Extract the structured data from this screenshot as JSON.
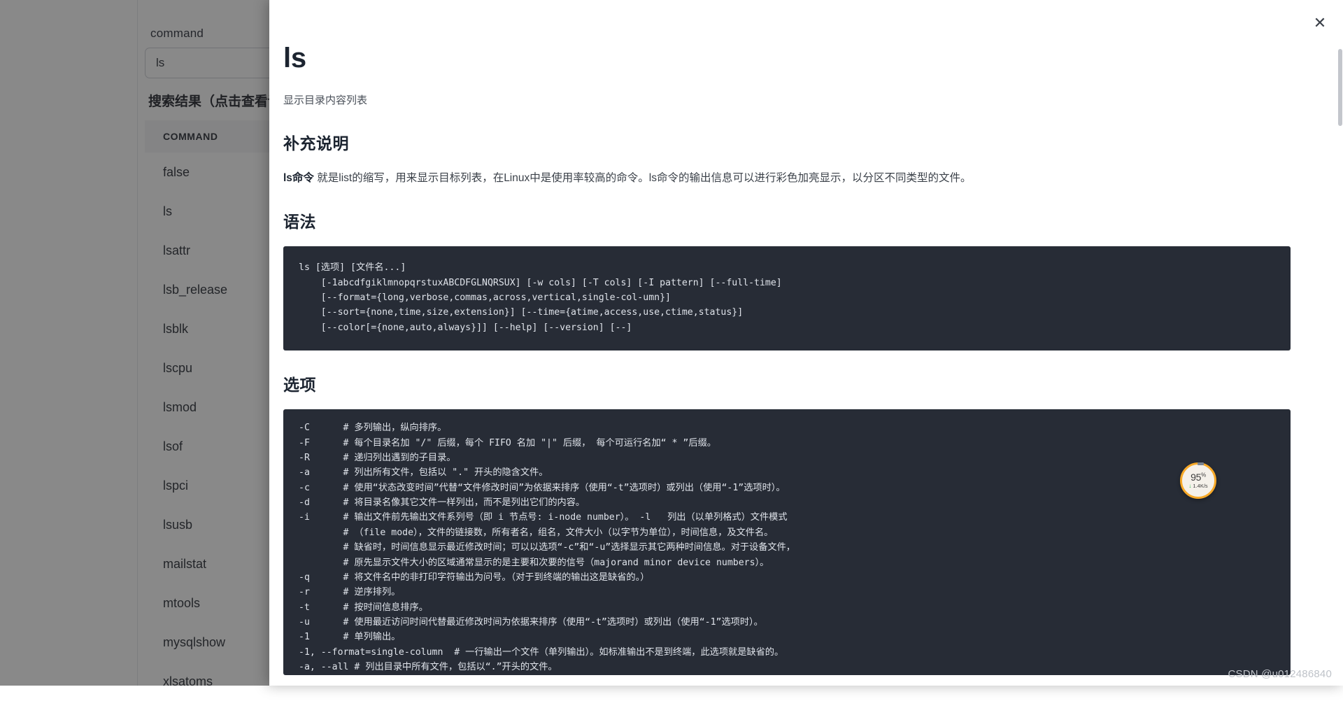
{
  "background": {
    "field_label": "command",
    "search_input_value": "ls",
    "search_input_placeholder": "command",
    "results_title": "搜索结果（点击查看详情）",
    "table": {
      "header": "COMMAND",
      "rows": [
        "false",
        "ls",
        "lsattr",
        "lsb_release",
        "lsblk",
        "lscpu",
        "lsmod",
        "lsof",
        "lspci",
        "lsusb",
        "mailstat",
        "mtools",
        "mysqlshow",
        "xlsatoms"
      ]
    }
  },
  "modal": {
    "close_icon_label": "✕",
    "title": "ls",
    "subtitle": "显示目录内容列表",
    "sections": [
      {
        "heading": "补充说明",
        "paragraph_bold": "ls命令",
        "paragraph_rest": " 就是list的缩写，用来显示目标列表，在Linux中是使用率较高的命令。ls命令的输出信息可以进行彩色加亮显示，以分区不同类型的文件。"
      },
      {
        "heading": "语法"
      },
      {
        "heading": "选项"
      }
    ],
    "syntax_code": "ls [选项] [文件名...]\n    [-1abcdfgiklmnopqrstuxABCDFGLNQRSUX] [-w cols] [-T cols] [-I pattern] [--full-time]\n    [--format={long,verbose,commas,across,vertical,single-col-umn}]\n    [--sort={none,time,size,extension}] [--time={atime,access,use,ctime,status}]\n    [--color[={none,auto,always}]] [--help] [--version] [--]",
    "options_code": "-C      # 多列输出，纵向排序。\n-F      # 每个目录名加 \"/\" 后缀，每个 FIFO 名加 \"|\" 后缀， 每个可运行名加“ * ”后缀。\n-R      # 递归列出遇到的子目录。\n-a      # 列出所有文件，包括以 \".\" 开头的隐含文件。\n-c      # 使用“状态改变时间”代替“文件修改时间”为依据来排序（使用“-t”选项时）或列出（使用“-1”选项时）。\n-d      # 将目录名像其它文件一样列出，而不是列出它们的内容。\n-i      # 输出文件前先输出文件系列号（即 i 节点号: i-node number）。 -l   列出（以单列格式）文件模式\n        # （file mode），文件的链接数，所有者名，组名，文件大小（以字节为单位），时间信息，及文件名。\n        # 缺省时，时间信息显示最近修改时间；可以以选项“-c”和“-u”选择显示其它两种时间信息。对于设备文件，\n        # 原先显示文件大小的区域通常显示的是主要和次要的信号（majorand minor device numbers）。\n-q      # 将文件名中的非打印字符输出为问号。（对于到终端的输出这是缺省的。）\n-r      # 逆序排列。\n-t      # 按时间信息排序。\n-u      # 使用最近访问时间代替最近修改时间为依据来排序（使用“-t”选项时）或列出（使用“-1”选项时）。\n-1      # 单列输出。\n-1, --format=single-column  # 一行输出一个文件（单列输出）。如标准输出不是到终端，此选项就是缺省的。\n-a, --all # 列出目录中所有文件，包括以“.”开头的文件。"
  },
  "download_badge": {
    "percent": "95",
    "percent_symbol": "%",
    "rate": "1.4K/s",
    "arrow_icon": "↓",
    "ring_color": "#f7a928",
    "arrow_color": "#2bbf4a"
  },
  "watermark": "CSDN @u012486840"
}
